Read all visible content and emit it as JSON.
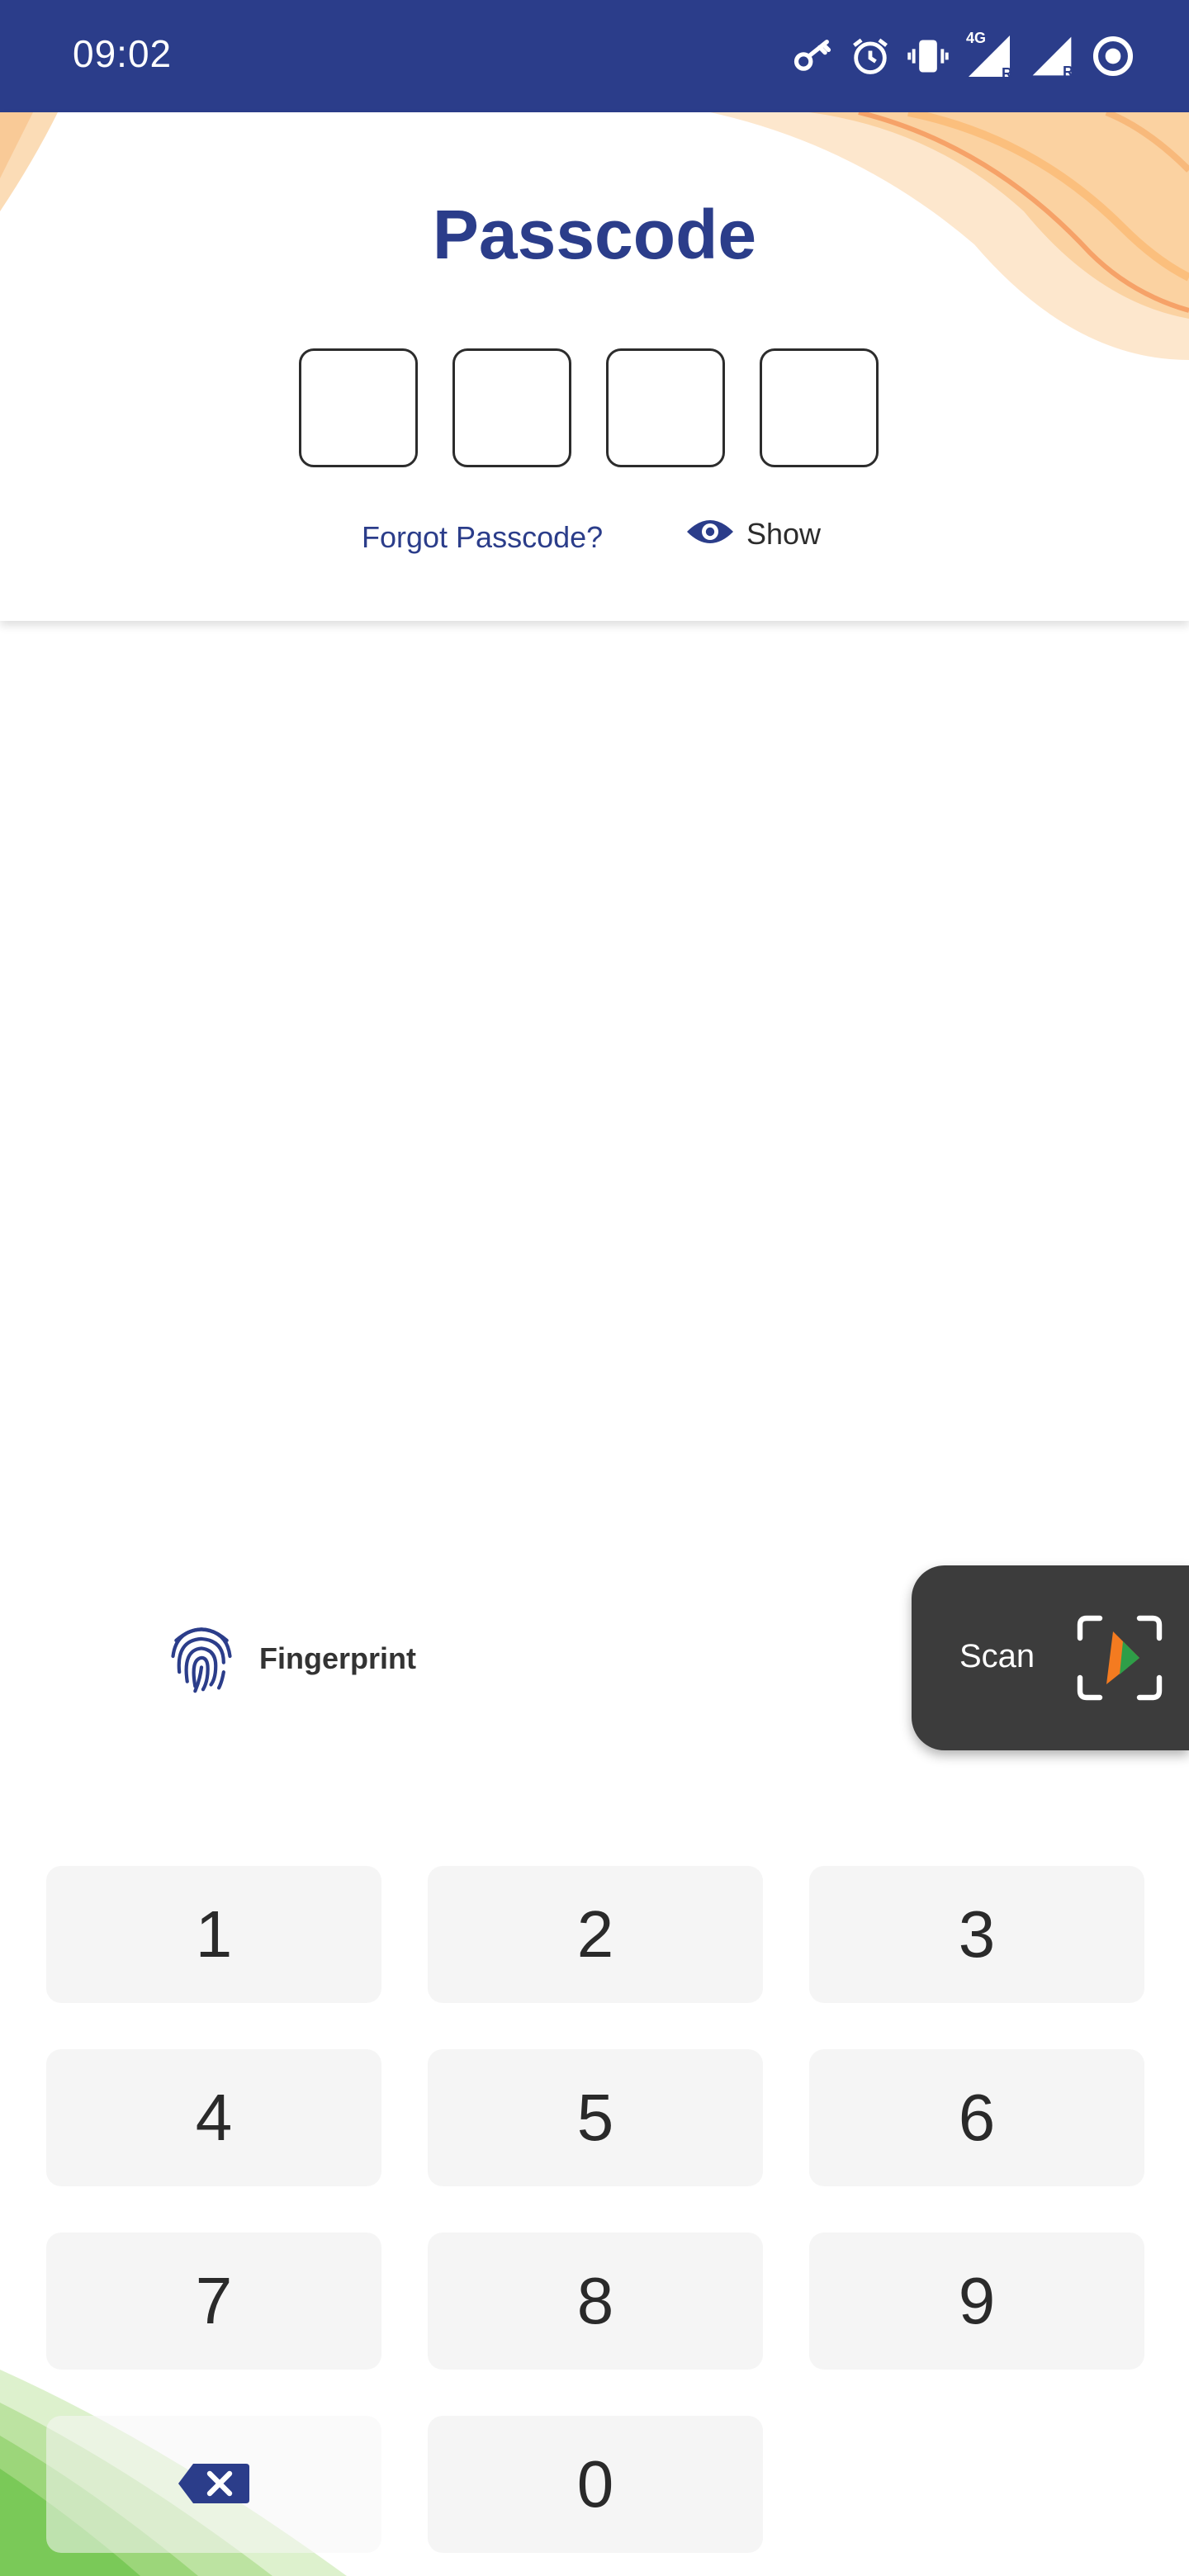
{
  "status_bar": {
    "time": "09:02",
    "icons": [
      "vpn-key-icon",
      "alarm-icon",
      "vibrate-icon",
      "network-4g-icon",
      "signal-r-icon",
      "signal-r-icon",
      "sync-icon"
    ],
    "network_label": "4G",
    "roaming_label": "R"
  },
  "header": {
    "title": "Passcode",
    "pin_boxes": [
      "",
      "",
      "",
      ""
    ],
    "forgot_label": "Forgot Passcode?",
    "show_label": "Show"
  },
  "fingerprint": {
    "label": "Fingerprint"
  },
  "scan": {
    "label": "Scan"
  },
  "keypad": {
    "keys": [
      "1",
      "2",
      "3",
      "4",
      "5",
      "6",
      "7",
      "8",
      "9",
      "0"
    ]
  },
  "colors": {
    "brand_blue": "#2b3d8a",
    "scan_bg": "#3c3c3c",
    "key_bg": "#f5f5f5",
    "swoosh_orange": "#f6a04d",
    "swoosh_green": "#6cc34a"
  }
}
